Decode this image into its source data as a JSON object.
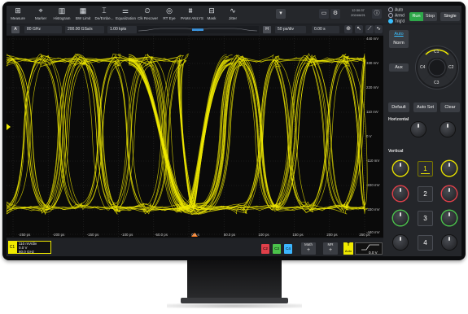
{
  "toolbar": {
    "items": [
      {
        "label": "Measure",
        "icon": "ruler-icon",
        "glyph": "⊞"
      },
      {
        "label": "Marker",
        "icon": "marker-icon",
        "glyph": "⌖"
      },
      {
        "label": "Histogram",
        "icon": "histogram-icon",
        "glyph": "▥"
      },
      {
        "label": "BW Limit",
        "icon": "bw-limit-icon",
        "glyph": "▦"
      },
      {
        "label": "De/Embe...",
        "icon": "deembed-icon",
        "glyph": "⌶"
      },
      {
        "label": "Equalization",
        "icon": "equalization-icon",
        "glyph": "⚌"
      },
      {
        "label": "Clk Recover",
        "icon": "clock-recover-icon",
        "glyph": "⏲"
      },
      {
        "label": "RT Eye",
        "icon": "eye-icon",
        "glyph": "◎"
      },
      {
        "label": "PAM4 ANLYS",
        "icon": "pam4-icon",
        "glyph": "⩩"
      },
      {
        "label": "Mask",
        "icon": "mask-icon",
        "glyph": "⊟"
      },
      {
        "label": "Jitter",
        "icon": "jitter-icon",
        "glyph": "∿"
      }
    ],
    "clock_time": "12:30:37",
    "clock_date": "2024/6/21",
    "trigger_modes": [
      "Auto",
      "Armd",
      "Trig'd"
    ],
    "run_label": "Run",
    "stop_label": "Stop",
    "single_label": "Single"
  },
  "timebase": {
    "a_label": "A",
    "bandwidth": "80 GHz",
    "sample_rate": "200.00 GSa/s",
    "memory_depth": "1.00 kpts",
    "h_label": "H",
    "time_div": "50 ps/div",
    "offset": "0.00 s"
  },
  "plot": {
    "y_labels": [
      "440 mV",
      "330 mV",
      "220 mV",
      "110 mV",
      "0 V",
      "-110 mV",
      "-220 mV",
      "-330 mV",
      "-440 mV"
    ],
    "x_labels": [
      "-250 ps",
      "-200 ps",
      "-150 ps",
      "-100 ps",
      "-50.0 ps",
      "0.0 s",
      "50.0 ps",
      "100 ps",
      "150 ps",
      "200 ps",
      "250 ps"
    ]
  },
  "panel": {
    "auto_label": "Auto",
    "norm_label": "Norm",
    "aux_label": "Aux",
    "default_label": "Default",
    "autoset_label": "Auto Set",
    "clear_label": "Clear",
    "horizontal_title": "Horizontal",
    "vertical_title": "Vertical",
    "wheel_labels": {
      "c1": "C1",
      "c2": "C2",
      "c3": "C3",
      "c4": "C4"
    },
    "channel_buttons": [
      "1",
      "2",
      "3",
      "4"
    ]
  },
  "bottom": {
    "c1_tag": "C1",
    "c1_scale": "110 mV/div",
    "c1_offset": "0.0 V",
    "c1_bw": "80.0 GHz",
    "channels": [
      "C2",
      "C3",
      "C4"
    ],
    "math_label": "Math",
    "mr_label": "MR",
    "plus": "+",
    "trig_label": "T",
    "trig_mode": "Auto",
    "trig_level": "0.0 V"
  },
  "colors": {
    "trace": "#f0ea00",
    "c2": "#e0404a",
    "c3": "#4bc24b",
    "c4": "#3cb6ff",
    "run": "#2ea84a"
  }
}
